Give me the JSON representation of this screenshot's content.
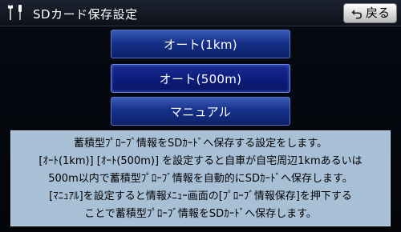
{
  "header": {
    "title": "SDカード保存設定",
    "back_label": "戻る"
  },
  "options": [
    {
      "label": "オート(1km)",
      "selected": false
    },
    {
      "label": "オート(500m)",
      "selected": true
    },
    {
      "label": "マニュアル",
      "selected": false
    }
  ],
  "info": {
    "lines": [
      "蓄積型ﾌﾟﾛｰﾌﾞ情報をSDｶｰﾄﾞへ保存する設定をします。",
      "[ｵｰﾄ(1km)] [ｵｰﾄ(500m)] を設定すると自車が自宅周辺1kmあるいは",
      "500m以内で蓄積型ﾌﾟﾛｰﾌﾞ情報を自動的にSDｶｰﾄﾞへ保存します。",
      "[ﾏﾆｭｱﾙ]を設定すると情報ﾒﾆｭｰ画面の[ﾌﾟﾛｰﾌﾞ情報保存]を押下する",
      "ことで蓄積型ﾌﾟﾛｰﾌﾞ情報をSDｶｰﾄﾞへ保存します。"
    ]
  },
  "colors": {
    "panel_bg": "#a8c0d6",
    "button_blue": "#16318a",
    "header_bg": "#1c2230"
  },
  "icons": {
    "settings": "wrench-screwdriver-icon",
    "back": "return-arrow-icon"
  }
}
